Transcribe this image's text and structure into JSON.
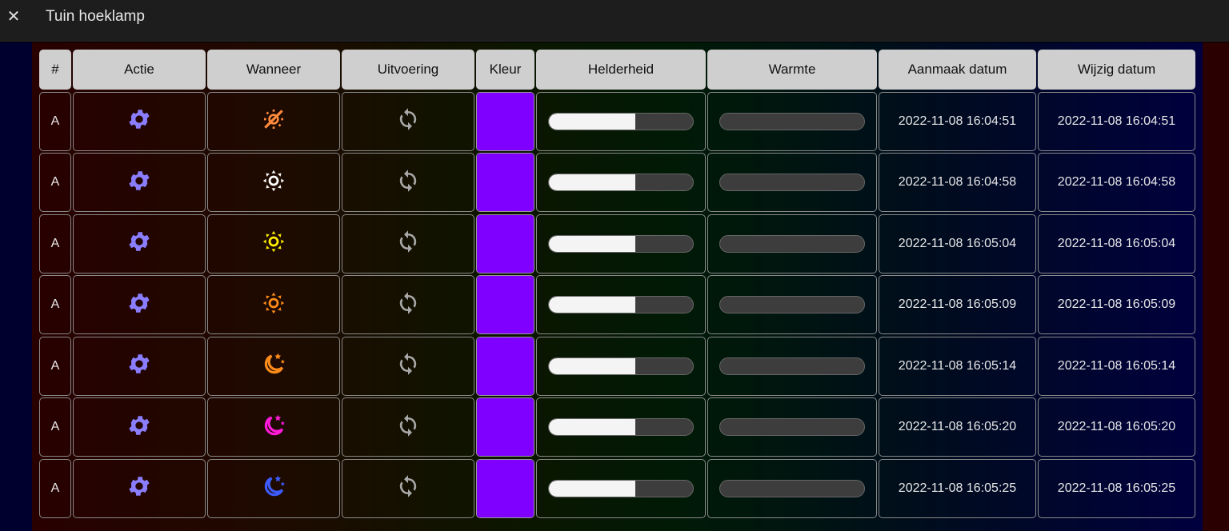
{
  "window": {
    "title": "Tuin hoeklamp",
    "close_glyph": "✕"
  },
  "table": {
    "headers": [
      "#",
      "Actie",
      "Wanneer",
      "Uitvoering",
      "Kleur",
      "Helderheid",
      "Warmte",
      "Aanmaak datum",
      "Wijzig datum"
    ],
    "rows": [
      {
        "id": "A",
        "action_icon": "gear-icon",
        "when_icon": "sun-down-icon",
        "when_color": "#ff8a3d",
        "exec_icon": "sync-icon",
        "color": "#7f00ff",
        "brightness": 0.6,
        "warmth": 0.0,
        "created": "2022-11-08 16:04:51",
        "modified": "2022-11-08 16:04:51"
      },
      {
        "id": "A",
        "action_icon": "gear-icon",
        "when_icon": "sun-icon",
        "when_color": "#ffffff",
        "exec_icon": "sync-icon",
        "color": "#7f00ff",
        "brightness": 0.6,
        "warmth": 0.0,
        "created": "2022-11-08 16:04:58",
        "modified": "2022-11-08 16:04:58"
      },
      {
        "id": "A",
        "action_icon": "gear-icon",
        "when_icon": "sun-icon",
        "when_color": "#ffee00",
        "exec_icon": "sync-icon",
        "color": "#7f00ff",
        "brightness": 0.6,
        "warmth": 0.0,
        "created": "2022-11-08 16:05:04",
        "modified": "2022-11-08 16:05:04"
      },
      {
        "id": "A",
        "action_icon": "gear-icon",
        "when_icon": "sun-icon",
        "when_color": "#ff8c1a",
        "exec_icon": "sync-icon",
        "color": "#7f00ff",
        "brightness": 0.6,
        "warmth": 0.0,
        "created": "2022-11-08 16:05:09",
        "modified": "2022-11-08 16:05:09"
      },
      {
        "id": "A",
        "action_icon": "gear-icon",
        "when_icon": "moon-stars-icon",
        "when_color": "#ff8c1a",
        "exec_icon": "sync-icon",
        "color": "#7f00ff",
        "brightness": 0.6,
        "warmth": 0.0,
        "created": "2022-11-08 16:05:14",
        "modified": "2022-11-08 16:05:14"
      },
      {
        "id": "A",
        "action_icon": "gear-icon",
        "when_icon": "moon-stars-icon",
        "when_color": "#ff1ad9",
        "exec_icon": "sync-icon",
        "color": "#7f00ff",
        "brightness": 0.6,
        "warmth": 0.0,
        "created": "2022-11-08 16:05:20",
        "modified": "2022-11-08 16:05:20"
      },
      {
        "id": "A",
        "action_icon": "gear-icon",
        "when_icon": "moon-stars-icon",
        "when_color": "#3d5cff",
        "exec_icon": "sync-icon",
        "color": "#7f00ff",
        "brightness": 0.6,
        "warmth": 0.0,
        "created": "2022-11-08 16:05:25",
        "modified": "2022-11-08 16:05:25"
      }
    ]
  },
  "colors": {
    "gear": "#8a7dff",
    "sync": "#a8a8a8"
  }
}
